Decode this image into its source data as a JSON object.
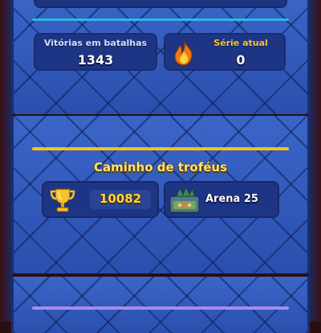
{
  "stats": {
    "wins_label": "Vitórias em batalhas",
    "wins_value": "1343",
    "streak_label": "Série atual",
    "streak_value": "0"
  },
  "trophy_road": {
    "title": "Caminho de troféus",
    "trophies": "10082",
    "arena": "Arena 25"
  },
  "icons": {
    "fire": "fire-icon",
    "trophy": "trophy-icon",
    "arena": "arena-icon"
  },
  "colors": {
    "panel_blue": "#2f56b3",
    "divider_cyan": "#2fb6e6",
    "divider_gold": "#f2c21d",
    "divider_purple": "#a98be9",
    "trophy_gold": "#ffd64a",
    "streak_label": "#f3c63b"
  }
}
